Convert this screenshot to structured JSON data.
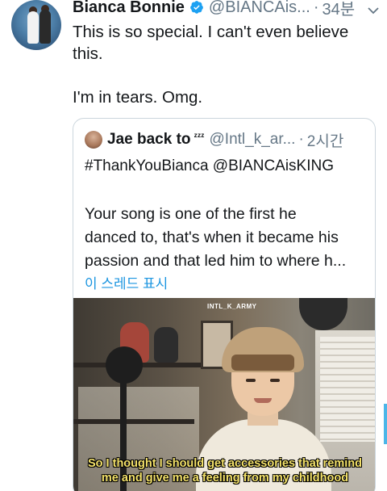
{
  "tweet": {
    "display_name": "Bianca Bonnie",
    "handle": "@BIANCAis...",
    "separator": "·",
    "time": "34분",
    "text_line1": "This is so special. I can't even believe",
    "text_line2": "this.",
    "text_line3": "I'm in tears. Omg.",
    "verified_icon": "verified-badge",
    "menu_icon": "chevron-down"
  },
  "quoted": {
    "display_name": "Jae back to",
    "name_emoji": "ᶻᶻᶻ",
    "handle": "@Intl_k_ar...",
    "separator": "·",
    "time": "2시간",
    "hashtags": "#ThankYouBianca @BIANCAisKING",
    "body_line1": "Your song is one of the first he",
    "body_line2": "danced to, that's when it became his",
    "body_line3": "passion and that led him to where h...",
    "show_thread": "이 스레드 표시",
    "media": {
      "watermark": "INTL_K_ARMY",
      "subtitle_line1": "So I thought I should get accessories that remind",
      "subtitle_line2": "me and give me a feeling from my childhood"
    }
  },
  "colors": {
    "text": "#14171a",
    "muted": "#657786",
    "link": "#1b95e0",
    "border": "#ccd6dd",
    "verified": "#1da1f2",
    "subtitle": "#f4e26a"
  }
}
